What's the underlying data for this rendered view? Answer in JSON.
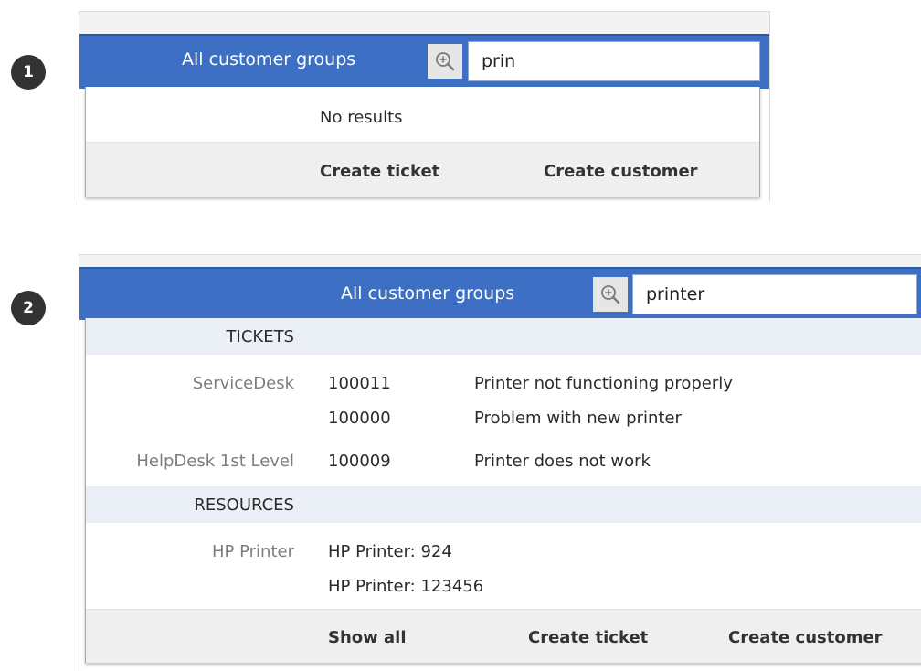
{
  "steps": [
    "1",
    "2"
  ],
  "panel1": {
    "group_label": "All customer groups",
    "search_value": "prin",
    "no_results": "No results",
    "footer": {
      "create_ticket": "Create ticket",
      "create_customer": "Create customer"
    }
  },
  "panel2": {
    "group_label": "All customer groups",
    "search_value": "printer",
    "sections": [
      {
        "header": "TICKETS",
        "groups": [
          {
            "name": "ServiceDesk",
            "rows": [
              {
                "id": "100011",
                "title": "Printer not functioning properly"
              },
              {
                "id": "100000",
                "title": "Problem with new printer"
              }
            ]
          },
          {
            "name": "HelpDesk 1st Level",
            "rows": [
              {
                "id": "100009",
                "title": "Printer does not work"
              }
            ]
          }
        ]
      },
      {
        "header": "RESOURCES",
        "groups": [
          {
            "name": "HP Printer",
            "rows": [
              {
                "id": "HP Printer: 924"
              },
              {
                "id": "HP Printer: 123456"
              }
            ]
          }
        ]
      }
    ],
    "footer": {
      "show_all": "Show all",
      "create_ticket": "Create ticket",
      "create_customer": "Create customer"
    }
  },
  "colors": {
    "bar": "#3d6fc4",
    "badge": "#333333",
    "section_header": "#ebf0f7",
    "footer": "#efefef"
  },
  "icons": {
    "search": "zoom-in-icon"
  }
}
